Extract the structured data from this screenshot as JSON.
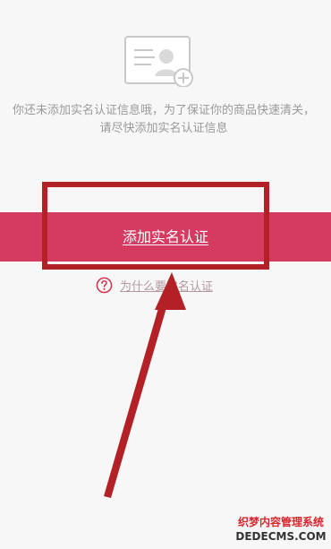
{
  "message": {
    "line1": "你还未添加实名认证信息哦，为了保证你的商品快速清关，",
    "line2": "请尽快添加实名认证信息"
  },
  "buttons": {
    "add_label": "添加实名认证"
  },
  "help": {
    "why_label": "为什么要实名认证"
  },
  "watermark": {
    "line1": "织梦内容管理系统",
    "line2": "DEDECMS.COM"
  },
  "icons": {
    "empty_state": "id-card-add-icon",
    "help": "question-circle-icon"
  },
  "colors": {
    "button_bg": "#d53b61",
    "annotation": "#b32025"
  }
}
